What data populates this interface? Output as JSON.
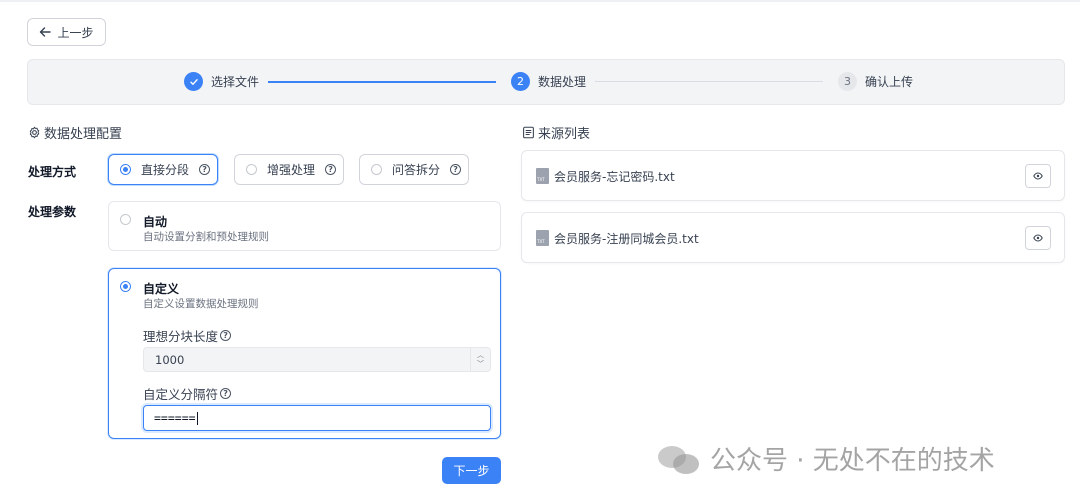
{
  "nav": {
    "back_label": "上一步"
  },
  "steps": [
    {
      "index": "1",
      "label": "选择文件",
      "state": "done"
    },
    {
      "index": "2",
      "label": "数据处理",
      "state": "active"
    },
    {
      "index": "3",
      "label": "确认上传",
      "state": "todo"
    }
  ],
  "config": {
    "title": "数据处理配置",
    "method_label": "处理方式",
    "methods": [
      {
        "label": "直接分段",
        "selected": true
      },
      {
        "label": "增强处理",
        "selected": false
      },
      {
        "label": "问答拆分",
        "selected": false
      }
    ],
    "params_label": "处理参数",
    "auto": {
      "title": "自动",
      "desc": "自动设置分割和预处理规则",
      "selected": false
    },
    "custom": {
      "title": "自定义",
      "desc": "自定义设置数据处理规则",
      "selected": true,
      "chunk_length_label": "理想分块长度",
      "chunk_length_value": "1000",
      "separator_label": "自定义分隔符",
      "separator_value": "======"
    },
    "next_label": "下一步"
  },
  "sources": {
    "title": "来源列表",
    "items": [
      {
        "name": "会员服务-忘记密码.txt"
      },
      {
        "name": "会员服务-注册同城会员.txt"
      }
    ]
  },
  "watermark": {
    "text": "公众号 · 无处不在的技术"
  },
  "colors": {
    "accent": "#3b82f6"
  }
}
